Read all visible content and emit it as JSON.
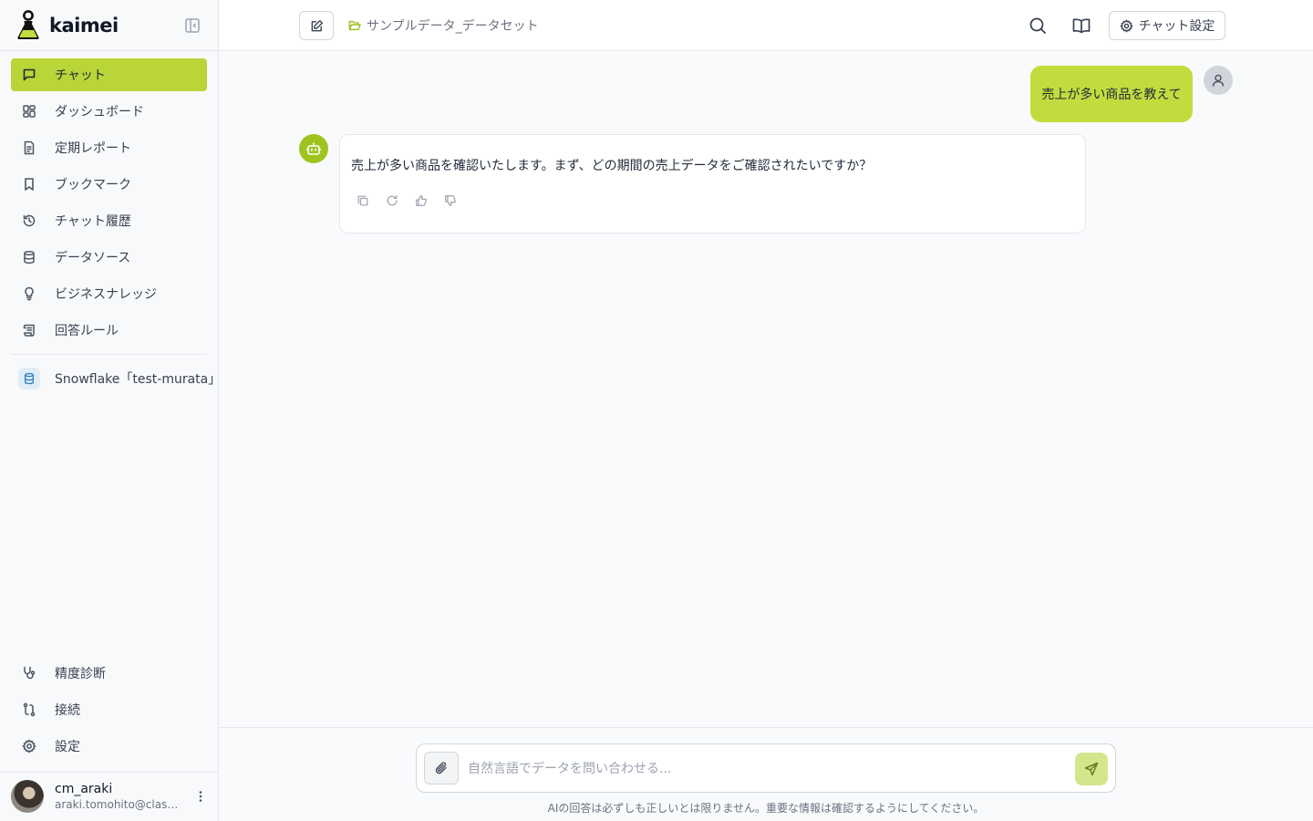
{
  "brand": {
    "name": "kaimei"
  },
  "colors": {
    "accent": "#b9d538",
    "bot": "#9fc41f",
    "user_bubble": "#c2dc3e"
  },
  "sidebar": {
    "items": [
      {
        "label": "チャット",
        "icon": "chat-bubble-icon",
        "active": true
      },
      {
        "label": "ダッシュボード",
        "icon": "dashboard-grid-icon"
      },
      {
        "label": "定期レポート",
        "icon": "report-document-icon"
      },
      {
        "label": "ブックマーク",
        "icon": "bookmark-icon"
      },
      {
        "label": "チャット履歴",
        "icon": "history-icon"
      },
      {
        "label": "データソース",
        "icon": "database-icon"
      },
      {
        "label": "ビジネスナレッジ",
        "icon": "lightbulb-icon"
      },
      {
        "label": "回答ルール",
        "icon": "scroll-icon"
      }
    ],
    "source": {
      "label": "Snowflake「test-murata」",
      "icon": "database-icon"
    },
    "bottom_items": [
      {
        "label": "精度診断",
        "icon": "stethoscope-icon"
      },
      {
        "label": "接続",
        "icon": "connection-icon"
      },
      {
        "label": "設定",
        "icon": "gear-icon"
      }
    ],
    "user": {
      "name": "cm_araki",
      "email": "araki.tomohito@class..."
    }
  },
  "header": {
    "dataset": "サンプルデータ_データセット",
    "settings_label": "チャット設定"
  },
  "chat": {
    "user_message": "売上が多い商品を教えて",
    "bot_message": "売上が多い商品を確認いたします。まず、どの期間の売上データをご確認されたいですか？"
  },
  "composer": {
    "placeholder": "自然言語でデータを問い合わせる...",
    "disclaimer": "AIの回答は必ずしも正しいとは限りません。重要な情報は確認するようにしてください。"
  }
}
